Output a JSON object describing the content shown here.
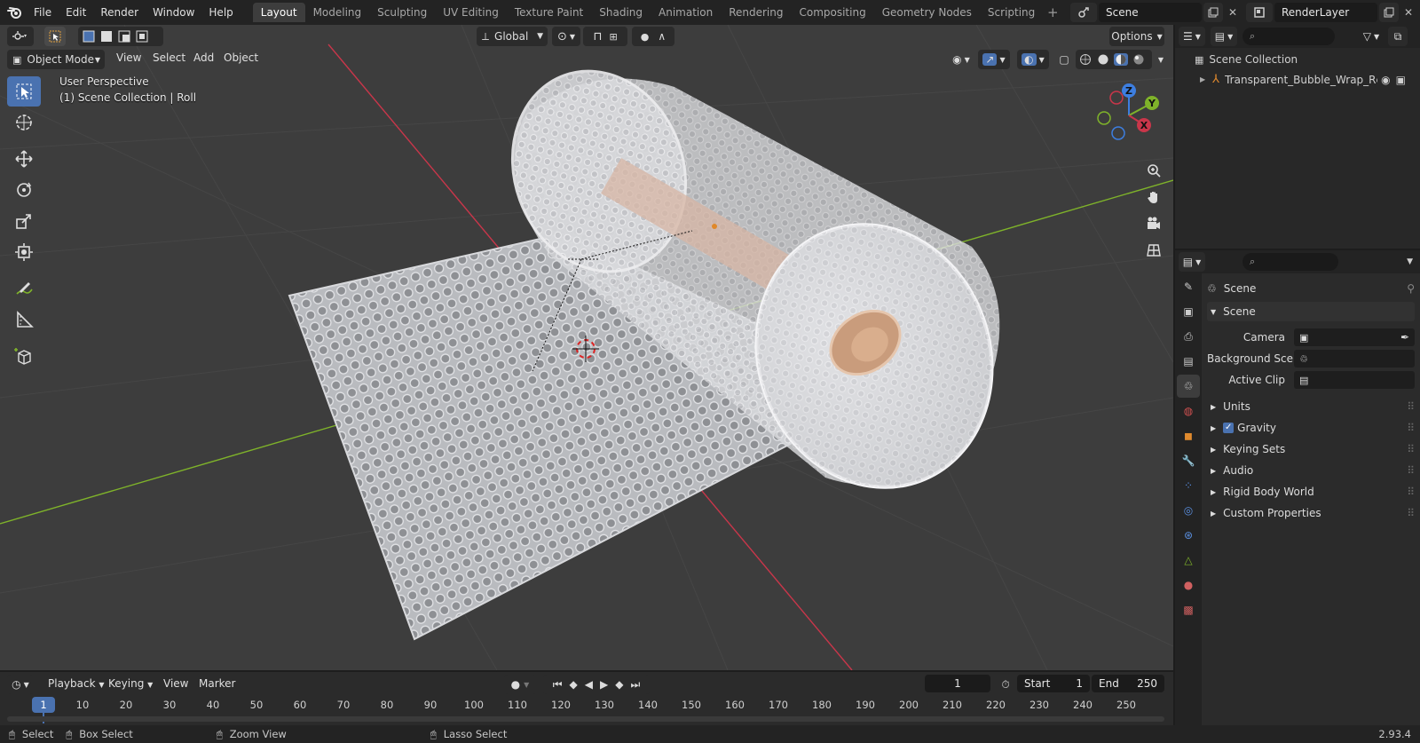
{
  "menu": [
    "File",
    "Edit",
    "Render",
    "Window",
    "Help"
  ],
  "workspaces": [
    "Layout",
    "Modeling",
    "Sculpting",
    "UV Editing",
    "Texture Paint",
    "Shading",
    "Animation",
    "Rendering",
    "Compositing",
    "Geometry Nodes",
    "Scripting"
  ],
  "active_workspace": "Layout",
  "scene_name": "Scene",
  "view_layer": "RenderLayer",
  "viewport": {
    "mode": "Object Mode",
    "menus": [
      "View",
      "Select",
      "Add",
      "Object"
    ],
    "transform_orientation": "Global",
    "options_label": "Options",
    "perspective_label": "User Perspective",
    "collection_label": "(1) Scene Collection | Roll",
    "axis_labels": {
      "x": "X",
      "y": "Y",
      "z": "Z"
    }
  },
  "outliner": {
    "root": "Scene Collection",
    "items": [
      {
        "label": "Transparent_Bubble_Wrap_Rc"
      }
    ]
  },
  "properties": {
    "header": "Scene",
    "section": "Scene",
    "fields": [
      {
        "label": "Camera",
        "value": ""
      },
      {
        "label": "Background Sce...",
        "value": ""
      },
      {
        "label": "Active Clip",
        "value": ""
      }
    ],
    "subpanels": [
      {
        "label": "Units",
        "checkbox": false
      },
      {
        "label": "Gravity",
        "checkbox": true
      },
      {
        "label": "Keying Sets",
        "checkbox": false
      },
      {
        "label": "Audio",
        "checkbox": false
      },
      {
        "label": "Rigid Body World",
        "checkbox": false
      },
      {
        "label": "Custom Properties",
        "checkbox": false
      }
    ]
  },
  "timeline": {
    "menus": [
      "Playback",
      "Keying",
      "View",
      "Marker"
    ],
    "current_frame": "1",
    "start_label": "Start",
    "start": "1",
    "end_label": "End",
    "end": "250",
    "ticks": [
      "1",
      "10",
      "20",
      "30",
      "40",
      "50",
      "60",
      "70",
      "80",
      "90",
      "100",
      "110",
      "120",
      "130",
      "140",
      "150",
      "160",
      "170",
      "180",
      "190",
      "200",
      "210",
      "220",
      "230",
      "240",
      "250"
    ]
  },
  "status": {
    "select": "Select",
    "box_select": "Box Select",
    "zoom_view": "Zoom View",
    "lasso_select": "Lasso Select",
    "version": "2.93.4"
  },
  "colors": {
    "accent": "#4a72b0",
    "x_axis": "#c9364a",
    "y_axis": "#7fb32a",
    "z_axis": "#3d7ee0",
    "viewport_bg": "#3d3d3d"
  }
}
